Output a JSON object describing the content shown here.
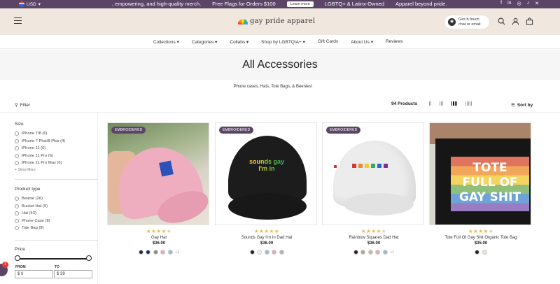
{
  "topbar": {
    "currency": "USD",
    "ticker_1": ", empowering, and high-quality merch.",
    "ticker_2": "Free Flags for Orders $100",
    "learn_more": "Learn more",
    "ticker_3": "LGBTQ+ & Latinx-Owned",
    "ticker_4": "Apparel beyond pride.",
    "socials": [
      "f",
      "in",
      "ig",
      "tt",
      "x"
    ]
  },
  "header": {
    "logo": "gay pride apparel",
    "chat_line1": "Get in touch",
    "chat_line2": "chat or email"
  },
  "nav": {
    "items": [
      "Collections",
      "Categories",
      "Collabs",
      "Shop by LGBTQIA+",
      "Gift Cards",
      "About Us",
      "Reviews"
    ]
  },
  "hero": {
    "title": "All Accessories",
    "subtitle": "Phone cases, Hats, Tote Bags, & Beenies!"
  },
  "toolbar": {
    "filter": "Filter",
    "count": "94 Products",
    "sort": "Sort by"
  },
  "sidebar": {
    "size_title": "Size",
    "size_options": [
      "iPhone 7/8 (6)",
      "iPhone 7 Plus/8 Plus (4)",
      "iPhone 11 (6)",
      "iPhone 11 Pro (6)",
      "iPhone 11 Pro Max (6)"
    ],
    "show_more": "+ Show More",
    "type_title": "Product type",
    "type_options": [
      "Beanie (26)",
      "Bucket Hat (9)",
      "Hat (43)",
      "Phone Case (8)",
      "Tote Bag (8)"
    ],
    "price_title": "Price",
    "from_label": "FROM",
    "to_label": "TO",
    "from_value": "$  0",
    "to_value": "$  39",
    "chat_badge": "1"
  },
  "products": [
    {
      "badge": "EMBROIDERED",
      "rating": 4,
      "name": "Gay Hat",
      "price": "$36.00",
      "swatches": [
        "#1f2a44",
        "#1a2a8a",
        "#8a8a80",
        "#e7a8bc",
        "#9ab8d9"
      ],
      "more": "+1"
    },
    {
      "badge": "EMBROIDERED",
      "rating": 5,
      "name": "Sounds Gay I'm In Dad Hat",
      "price": "$36.00",
      "swatches": [
        "#222222",
        "#f2f2f2",
        "#9ab8d9",
        "#e7a8bc",
        "#b9b3a5"
      ],
      "more": ""
    },
    {
      "badge": "EMBROIDERED",
      "rating": 4,
      "name": "Rainbow Squares Dad Hat",
      "price": "$36.00",
      "swatches": [
        "#222222",
        "#b7a58c",
        "#c9b79c",
        "#e7a8bc",
        "#9ab8d9"
      ],
      "more": "+1"
    },
    {
      "badge": "",
      "rating": 4,
      "name": "Tote Full Of Gay Shit Organic Tote Bag",
      "price": "$35.00",
      "swatches": [
        "#222222",
        "#efe3cf"
      ],
      "more": ""
    }
  ],
  "tote_text": [
    "TOTE",
    "FULL OF",
    "GAY SHIT"
  ],
  "hat2_text": [
    "sounds gay",
    "I'm in"
  ],
  "colors": {
    "brand": "#5b4566",
    "header_bg": "#f0e7de",
    "star": "#e9b949"
  }
}
